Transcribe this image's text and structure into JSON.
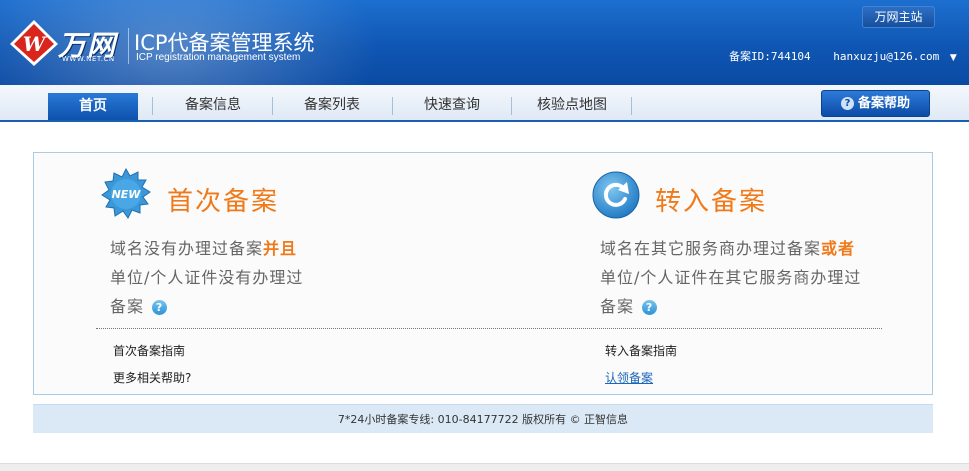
{
  "header": {
    "logo_text": "万网",
    "logo_url": "WWW.NET.CN",
    "title": "ICP代备案管理系统",
    "subtitle": "ICP registration management system",
    "main_site_label": "万网主站",
    "record_id": "备案ID:744104",
    "email": "hanxuzju@126.com",
    "caret": "▼"
  },
  "nav": {
    "items": [
      {
        "label": "首页",
        "active": true
      },
      {
        "label": "备案信息"
      },
      {
        "label": "备案列表"
      },
      {
        "label": "快速查询"
      },
      {
        "label": "核验点地图"
      }
    ],
    "help_label": "备案帮助",
    "help_icon": "?"
  },
  "first": {
    "badge": "NEW",
    "title": "首次备案",
    "line1_a": "域名没有办理过备案",
    "line1_b": "并且",
    "line2": "单位/个人证件没有办理过",
    "line3": "备案",
    "guide": "首次备案指南",
    "more_help": "更多相关帮助?"
  },
  "transfer": {
    "title": "转入备案",
    "line1_a": "域名在其它服务商办理过备案",
    "line1_b": "或者",
    "line2": "单位/个人证件在其它服务商办理过",
    "line3": "备案",
    "guide": "转入备案指南",
    "claim": "认领备案"
  },
  "qmark": "?",
  "footer": {
    "text": "7*24小时备案专线: 010-84177722 版权所有 © 正智信息"
  },
  "colors": {
    "header_blue": "#0f56b3",
    "accent_orange": "#f07a1a",
    "link_blue": "#1a66b8"
  }
}
